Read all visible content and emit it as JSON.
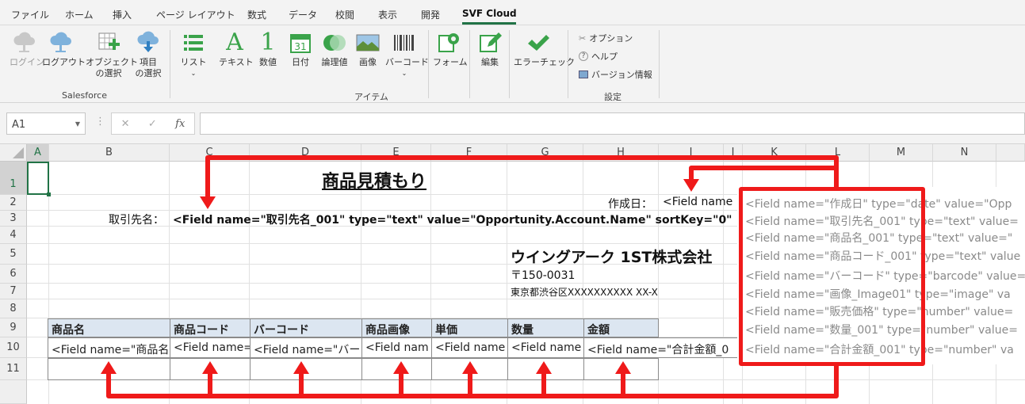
{
  "ribbon": {
    "tabs": [
      "ファイル",
      "ホーム",
      "挿入",
      "ページ レイアウト",
      "数式",
      "データ",
      "校閲",
      "表示",
      "開発",
      "SVF Cloud"
    ],
    "active_tab": "SVF Cloud",
    "buttons": {
      "login": "ログイン",
      "logout": "ログアウト",
      "object_select": [
        "オブジェクト",
        "の選択"
      ],
      "field_select": [
        "項目",
        "の選択"
      ],
      "list": "リスト",
      "text": "テキスト",
      "number": "数値",
      "date": "日付",
      "bool": "論理値",
      "image": "画像",
      "barcode": "バーコード",
      "form": "フォーム",
      "edit": "編集",
      "error_check": "エラーチェック",
      "options": "オプション",
      "help": "ヘルプ",
      "version": "バージョン情報"
    },
    "groups": {
      "salesforce": "Salesforce",
      "items": "アイテム",
      "settings": "設定"
    },
    "icons": {
      "calendar_day": "31"
    }
  },
  "formula_bar": {
    "name_box": "A1",
    "value": ""
  },
  "grid": {
    "columns": [
      "A",
      "B",
      "C",
      "D",
      "E",
      "F",
      "G",
      "H",
      "I",
      "J",
      "K",
      "L",
      "M",
      "N"
    ],
    "rows": [
      "1",
      "2",
      "3",
      "4",
      "5",
      "6",
      "7",
      "8",
      "9",
      "10",
      "11"
    ]
  },
  "sheet": {
    "title": "商品見積もり",
    "created_label": "作成日：",
    "created_value": "<Field name",
    "client_label": "取引先名：",
    "client_field": "<Field name=\"取引先名_001\" type=\"text\" value=\"Opportunity.Account.Name\" sortKey=\"0\"",
    "company_name": "ウイングアーク 1ST株式会社",
    "company_logo_text": "1ST",
    "postal": "〒150-0031",
    "address": "東京都渋谷区XXXXXXXXXX XX-X",
    "table_headers": [
      "商品名",
      "商品コード",
      "バーコード",
      "商品画像",
      "単価",
      "数量",
      "金額"
    ],
    "table_fields": [
      "<Field name=\"商品名",
      "<Field name=",
      "<Field name=\"バー",
      "<Field nam",
      "<Field name",
      "<Field name",
      "<Field name=\"合計金額_0"
    ]
  },
  "field_list": [
    "<Field name=\"作成日\" type=\"date\" value=\"Opp",
    "<Field name=\"取引先名_001\" type=\"text\" value=",
    "<Field name=\"商品名_001\" type=\"text\" value=\"",
    "<Field name=\"商品コード_001\" type=\"text\" value",
    "<Field name=\"バーコード\" type=\"barcode\" value=",
    "<Field name=\"画像_Image01\" type=\"image\" va",
    "<Field name=\"販売価格\" type=\"number\" value=",
    "<Field name=\"数量_001\" type=\"number\" value=",
    "<Field name=\"合計金額_001\" type=\"number\" va"
  ],
  "colors": {
    "excel_green": "#217346",
    "annotation_red": "#ef1a1a",
    "header_fill": "#dce6f1"
  }
}
